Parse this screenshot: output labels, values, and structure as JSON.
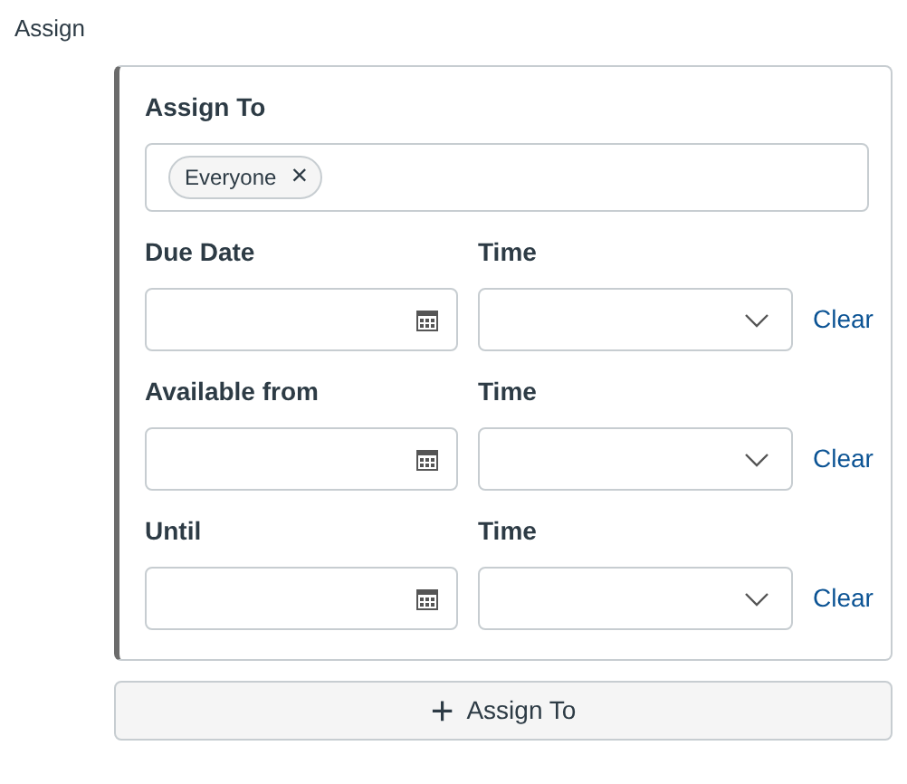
{
  "section_label": "Assign",
  "card": {
    "assign_to_label": "Assign To",
    "tags": [
      {
        "label": "Everyone",
        "remove": "×"
      }
    ],
    "date_rows": [
      {
        "date_label": "Due Date",
        "time_label": "Time",
        "clear": "Clear"
      },
      {
        "date_label": "Available from",
        "time_label": "Time",
        "clear": "Clear"
      },
      {
        "date_label": "Until",
        "time_label": "Time",
        "clear": "Clear"
      }
    ]
  },
  "add_button": {
    "icon": "+",
    "label": "Assign To"
  }
}
